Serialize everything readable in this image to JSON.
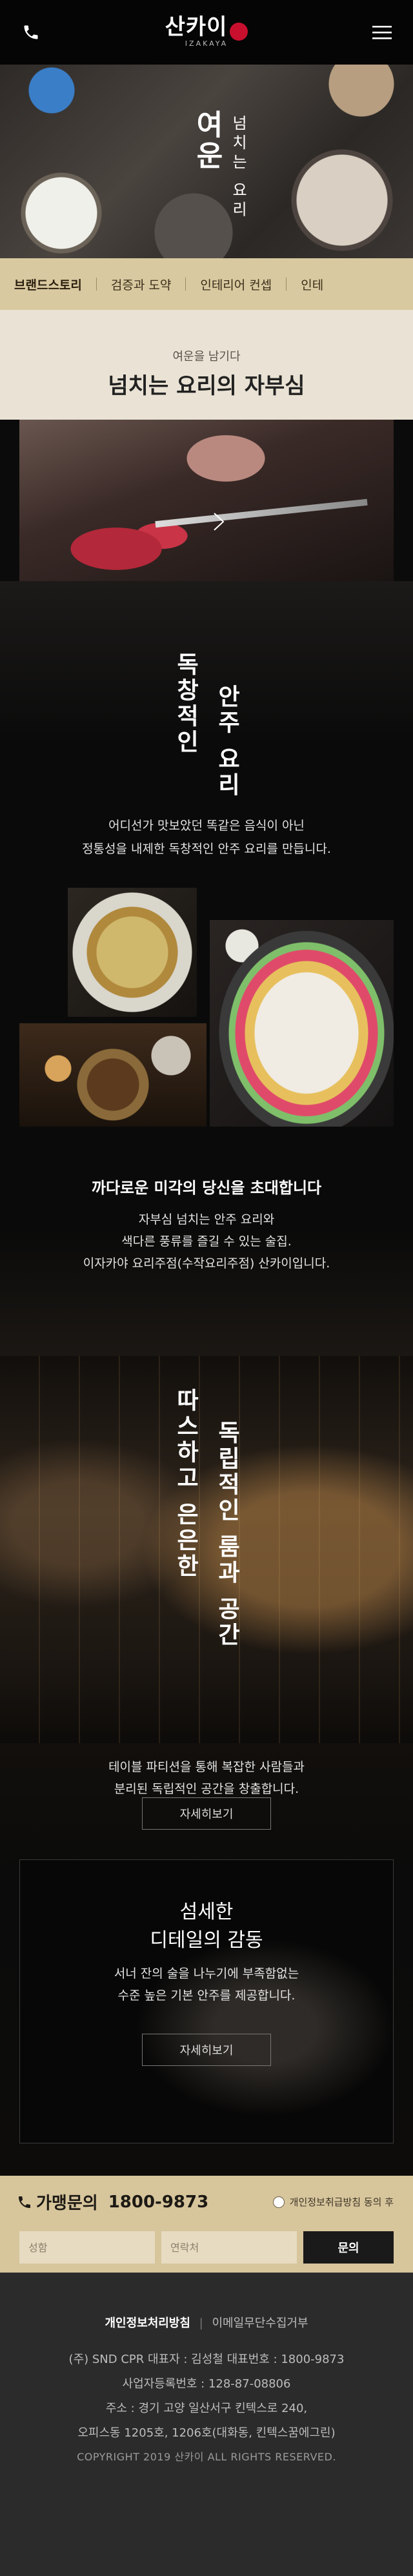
{
  "header": {
    "logo_text": "산카이",
    "logo_sub": "IZAKAYA"
  },
  "hero": {
    "title": "여운",
    "subtitle": "넘치는 요리"
  },
  "tabs": [
    "브랜드스토리",
    "검증과 도약",
    "인테리어 컨셉",
    "인테"
  ],
  "intro": {
    "kicker": "여운을 남기다",
    "title": "넘치는 요리의 자부심"
  },
  "section_food": {
    "vtitle_1": "독창적인",
    "vtitle_2": "안주 요리",
    "desc_line1": "어디선가 맛보았던 똑같은 음식이 아닌",
    "desc_line2": "정통성을 내제한 독창적인 안주 요리를 만듭니다."
  },
  "section_taste": {
    "heading": "까다로운 미각의 당신을 초대합니다",
    "line1": "자부심 넘치는 안주 요리와",
    "line2": "색다른 풍류를 즐길 수 있는 술집.",
    "line3": "이자카야 요리주점(수작요리주점) 산카이입니다."
  },
  "section_space": {
    "vtitle_1": "따스하고 은은한",
    "vtitle_2": "독립적인 룸과 공간",
    "line1": "테이블 파티션을 통해 복잡한 사람들과",
    "line2": "분리된 독립적인 공간을 창출합니다.",
    "button": "자세히보기"
  },
  "section_detail": {
    "title1": "섬세한",
    "title2": "디테일의 감동",
    "line1": "서너 잔의 술을 나누기에 부족함없는",
    "line2": "수준 높은 기본 안주를 제공합니다.",
    "button": "자세히보기"
  },
  "contact": {
    "label": "가맹문의",
    "phone": "1800-9873",
    "agree": "개인정보취급방침 동의 후",
    "name_placeholder": "성함",
    "tel_placeholder": "연락처",
    "submit": "문의"
  },
  "footer": {
    "privacy": "개인정보처리방침",
    "sep": "|",
    "email_refuse": "이메일무단수집거부",
    "line1": "(주) SND CPR    대표자 : 김성철    대표번호 : 1800-9873",
    "line2": "사업자등록번호 : 128-87-08806",
    "line3": "주소 : 경기 고양 일산서구 킨텍스로 240,",
    "line4": "오피스동 1205호, 1206호(대화동, 킨텍스꿈에그린)",
    "copyright": "COPYRIGHT 2019 산카이 ALL RIGHTS RESERVED."
  },
  "colors": {
    "accent_gold": "#d8c9a0",
    "contact_bg": "#d7c59c",
    "logo_red": "#c8102e",
    "footer_bg": "#2b2b2b"
  },
  "icons": [
    "phone-icon",
    "menu-icon",
    "play-icon",
    "phone-small-icon"
  ]
}
